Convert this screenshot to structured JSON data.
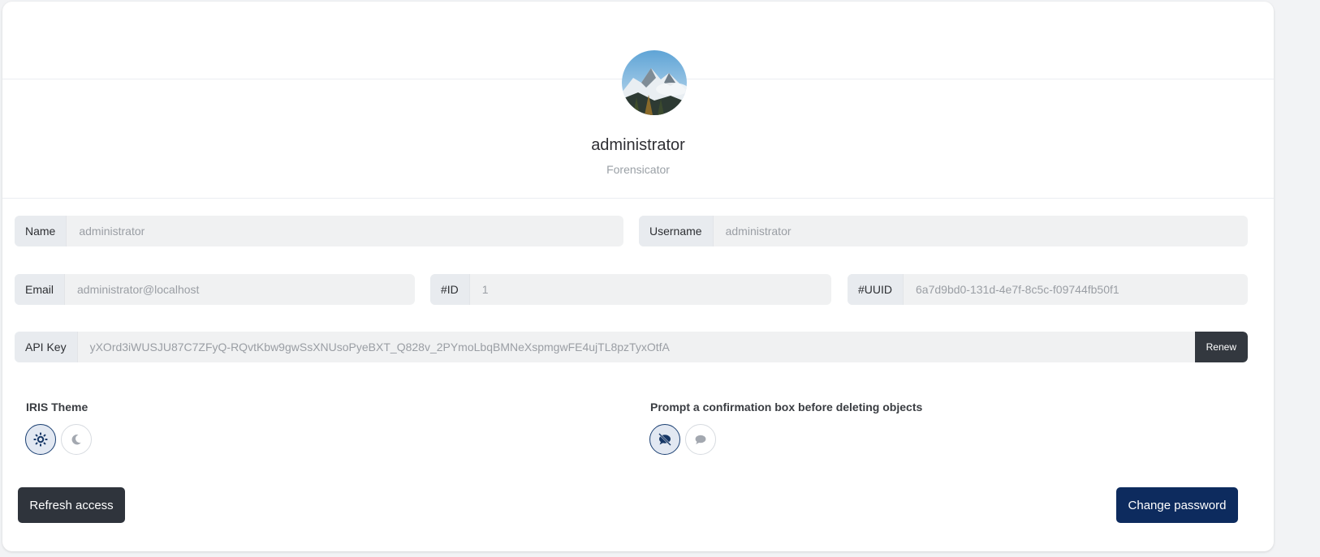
{
  "profile": {
    "name": "administrator",
    "role": "Forensicator"
  },
  "fields": {
    "name": {
      "label": "Name",
      "value": "administrator"
    },
    "username": {
      "label": "Username",
      "value": "administrator"
    },
    "email": {
      "label": "Email",
      "value": "administrator@localhost"
    },
    "id": {
      "label": "#ID",
      "value": "1"
    },
    "uuid": {
      "label": "#UUID",
      "value": "6a7d9bd0-131d-4e7f-8c5c-f09744fb50f1"
    },
    "api_key": {
      "label": "API Key",
      "value": "yXOrd3iWUSJU87C7ZFyQ-RQvtKbw9gwSsXNUsoPyeBXT_Q828v_2PYmoLbqBMNeXspmgwFE4ujTL8pzTyxOtfA",
      "renew_label": "Renew"
    }
  },
  "theme": {
    "title": "IRIS Theme",
    "options": [
      {
        "icon": "sun-icon",
        "active": true
      },
      {
        "icon": "moon-icon",
        "active": false
      }
    ]
  },
  "confirm_delete": {
    "title": "Prompt a confirmation box before deleting objects",
    "options": [
      {
        "icon": "comment-slash-icon",
        "active": true
      },
      {
        "icon": "comment-icon",
        "active": false
      }
    ]
  },
  "actions": {
    "refresh_label": "Refresh access",
    "change_password_label": "Change password"
  },
  "colors": {
    "primary": "#0d2b5e",
    "dark": "#2f343c",
    "field_bg": "#f0f1f2"
  }
}
